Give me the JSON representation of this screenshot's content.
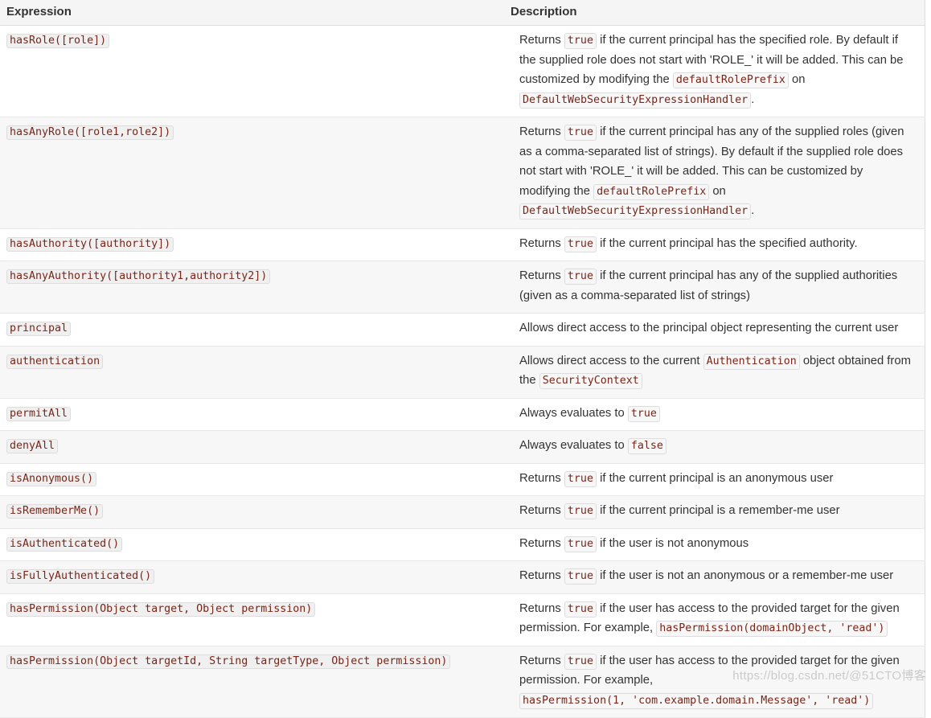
{
  "table": {
    "headers": {
      "expression": "Expression",
      "description": "Description"
    },
    "rows": [
      {
        "expression": "hasRole([role])",
        "description_parts": [
          {
            "type": "text",
            "value": "Returns "
          },
          {
            "type": "code",
            "value": "true"
          },
          {
            "type": "text",
            "value": " if the current principal has the specified role. By default if the supplied role does not start with 'ROLE_' it will be added. This can be customized by modifying the "
          },
          {
            "type": "code",
            "value": "defaultRolePrefix"
          },
          {
            "type": "text",
            "value": " on "
          },
          {
            "type": "code",
            "value": "DefaultWebSecurityExpressionHandler"
          },
          {
            "type": "text",
            "value": "."
          }
        ]
      },
      {
        "expression": "hasAnyRole([role1,role2])",
        "description_parts": [
          {
            "type": "text",
            "value": "Returns "
          },
          {
            "type": "code",
            "value": "true"
          },
          {
            "type": "text",
            "value": " if the current principal has any of the supplied roles (given as a comma-separated list of strings). By default if the supplied role does not start with 'ROLE_' it will be added. This can be customized by modifying the "
          },
          {
            "type": "code",
            "value": "defaultRolePrefix"
          },
          {
            "type": "text",
            "value": " on "
          },
          {
            "type": "code",
            "value": "DefaultWebSecurityExpressionHandler"
          },
          {
            "type": "text",
            "value": "."
          }
        ]
      },
      {
        "expression": "hasAuthority([authority])",
        "description_parts": [
          {
            "type": "text",
            "value": "Returns "
          },
          {
            "type": "code",
            "value": "true"
          },
          {
            "type": "text",
            "value": " if the current principal has the specified authority."
          }
        ]
      },
      {
        "expression": "hasAnyAuthority([authority1,authority2])",
        "description_parts": [
          {
            "type": "text",
            "value": "Returns "
          },
          {
            "type": "code",
            "value": "true"
          },
          {
            "type": "text",
            "value": " if the current principal has any of the supplied authorities (given as a comma-separated list of strings)"
          }
        ]
      },
      {
        "expression": "principal",
        "description_parts": [
          {
            "type": "text",
            "value": "Allows direct access to the principal object representing the current user"
          }
        ]
      },
      {
        "expression": "authentication",
        "description_parts": [
          {
            "type": "text",
            "value": "Allows direct access to the current "
          },
          {
            "type": "code",
            "value": "Authentication"
          },
          {
            "type": "text",
            "value": " object obtained from the "
          },
          {
            "type": "code",
            "value": "SecurityContext"
          }
        ]
      },
      {
        "expression": "permitAll",
        "description_parts": [
          {
            "type": "text",
            "value": "Always evaluates to "
          },
          {
            "type": "code",
            "value": "true"
          }
        ]
      },
      {
        "expression": "denyAll",
        "description_parts": [
          {
            "type": "text",
            "value": "Always evaluates to "
          },
          {
            "type": "code",
            "value": "false"
          }
        ]
      },
      {
        "expression": "isAnonymous()",
        "description_parts": [
          {
            "type": "text",
            "value": "Returns "
          },
          {
            "type": "code",
            "value": "true"
          },
          {
            "type": "text",
            "value": " if the current principal is an anonymous user"
          }
        ]
      },
      {
        "expression": "isRememberMe()",
        "description_parts": [
          {
            "type": "text",
            "value": "Returns "
          },
          {
            "type": "code",
            "value": "true"
          },
          {
            "type": "text",
            "value": " if the current principal is a remember-me user"
          }
        ]
      },
      {
        "expression": "isAuthenticated()",
        "description_parts": [
          {
            "type": "text",
            "value": "Returns "
          },
          {
            "type": "code",
            "value": "true"
          },
          {
            "type": "text",
            "value": " if the user is not anonymous"
          }
        ]
      },
      {
        "expression": "isFullyAuthenticated()",
        "description_parts": [
          {
            "type": "text",
            "value": "Returns "
          },
          {
            "type": "code",
            "value": "true"
          },
          {
            "type": "text",
            "value": " if the user is not an anonymous or a remember-me user"
          }
        ]
      },
      {
        "expression": "hasPermission(Object target, Object permission)",
        "description_parts": [
          {
            "type": "text",
            "value": "Returns "
          },
          {
            "type": "code",
            "value": "true"
          },
          {
            "type": "text",
            "value": " if the user has access to the provided target for the given permission. For example, "
          },
          {
            "type": "code",
            "value": "hasPermission(domainObject, 'read')"
          }
        ]
      },
      {
        "expression": "hasPermission(Object targetId, String targetType, Object permission)",
        "description_parts": [
          {
            "type": "text",
            "value": "Returns "
          },
          {
            "type": "code",
            "value": "true"
          },
          {
            "type": "text",
            "value": " if the user has access to the provided target for the given permission. For example, "
          },
          {
            "type": "code",
            "value": "hasPermission(1, 'com.example.domain.Message', 'read')"
          }
        ]
      }
    ]
  },
  "watermark": {
    "text": "https://blog.csdn.net/@51CTO博客"
  },
  "colors": {
    "code_text": "#7a2518",
    "header_background": "#f5f5f5",
    "row_alt_background": "#f7f7f7",
    "border": "#dddddd",
    "body_text": "#333333"
  }
}
